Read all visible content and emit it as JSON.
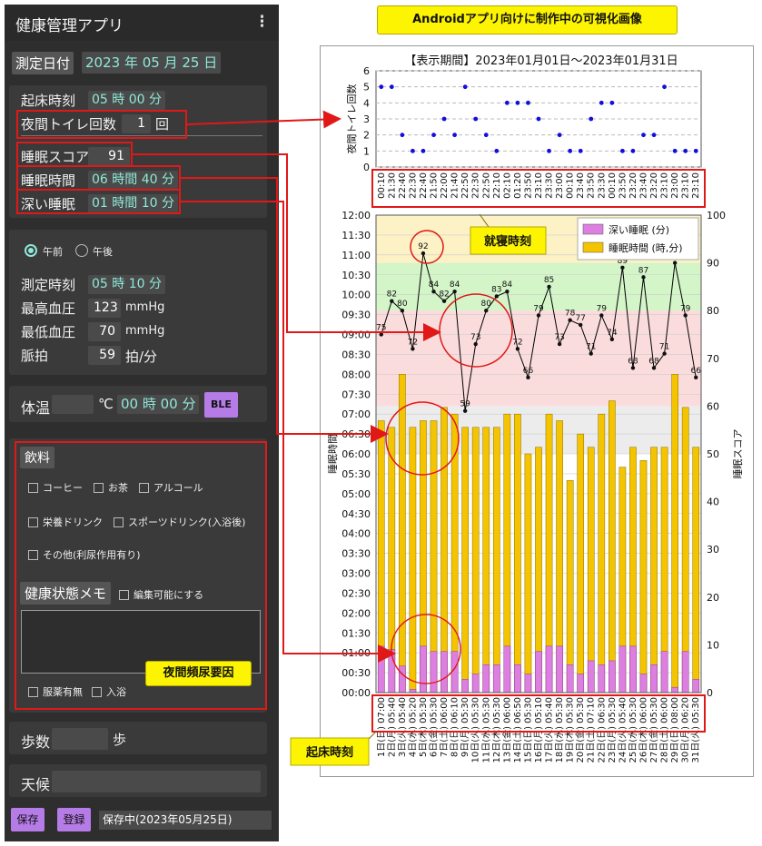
{
  "app": {
    "title": "健康管理アプリ",
    "menu_icon": "⋮"
  },
  "date_row": {
    "label": "測定日付",
    "value": "2023 年 05 月 25 日"
  },
  "sleep": {
    "wake_label": "起床時刻",
    "wake_value": "05 時 00 分",
    "toilet_label": "夜間トイレ回数",
    "toilet_value": "1",
    "toilet_unit": "回",
    "score_label": "睡眠スコア",
    "score_value": "91",
    "duration_label": "睡眠時間",
    "duration_value": "06 時間 40 分",
    "deep_label": "深い睡眠",
    "deep_value": "01 時間 10 分"
  },
  "blood": {
    "am_label": "午前",
    "pm_label": "午後",
    "time_label": "測定時刻",
    "time_value": "05 時 10 分",
    "sys_label": "最高血圧",
    "sys_value": "123",
    "sys_unit": "mmHg",
    "dia_label": "最低血圧",
    "dia_value": "70",
    "dia_unit": "mmHg",
    "pulse_label": "脈拍",
    "pulse_value": "59",
    "pulse_unit": "拍/分"
  },
  "temp": {
    "label": "体温",
    "unit": "℃",
    "time_value": "00 時 00 分",
    "ble_label": "BLE"
  },
  "drinks": {
    "header": "飲料",
    "items": [
      "コーヒー",
      "お茶",
      "アルコール",
      "栄養ドリンク",
      "スポーツドリンク(入浴後)",
      "その他(利尿作用有り)"
    ]
  },
  "memo": {
    "header": "健康状態メモ",
    "editable_label": "編集可能にする",
    "med_label": "服薬有無",
    "bath_label": "入浴"
  },
  "steps": {
    "label": "歩数",
    "unit": "歩"
  },
  "weather": {
    "label": "天候"
  },
  "footer": {
    "save_label": "保存",
    "register_label": "登録",
    "status": "保存中(2023年05月25日)"
  },
  "annotations": {
    "top": "Androidアプリ向けに制作中の可視化画像",
    "bedtime": "就寝時刻",
    "nocturia": "夜間頻尿要因",
    "wake": "起床時刻"
  },
  "colors": {
    "deep_sleep": "#dd7fe0",
    "sleep_time": "#f4c400",
    "score_line": "#000000",
    "toilet_dot": "#1010dd",
    "highlight": "#e01818",
    "note": "#fcf400"
  },
  "chart_data": [
    {
      "type": "scatter",
      "title": "【表示期間】2023年01月01日〜2023年01月31日",
      "ylabel": "夜間トイレ回数",
      "ylim": [
        0,
        6
      ],
      "yticks": [
        0,
        1,
        2,
        3,
        4,
        5,
        6
      ],
      "grid": true,
      "categories": [
        "00:10",
        "21:30",
        "22:40",
        "22:30",
        "22:40",
        "21:50",
        "22:00",
        "21:40",
        "22:50",
        "22:30",
        "22:50",
        "22:10",
        "02:10",
        "01:20",
        "23:50",
        "23:10",
        "23:30",
        "23:00",
        "00:10",
        "23:40",
        "23:50",
        "23:30",
        "00:10",
        "23:50",
        "23:20",
        "23:40",
        "23:20",
        "23:10",
        "23:00",
        "23:10",
        "23:10"
      ],
      "values": [
        5,
        5,
        2,
        1,
        1,
        2,
        3,
        2,
        5,
        3,
        2,
        1,
        4,
        4,
        4,
        3,
        1,
        2,
        1,
        1,
        3,
        4,
        4,
        1,
        1,
        2,
        2,
        5,
        1,
        1,
        1
      ]
    },
    {
      "type": "bar",
      "xlabel": "",
      "ylabel": "睡眠時間",
      "y2label": "睡眠スコア",
      "ylim": [
        "00:00",
        "12:00"
      ],
      "y2lim": [
        0,
        100
      ],
      "yticks": [
        "00:00",
        "00:30",
        "01:00",
        "01:30",
        "02:00",
        "02:30",
        "03:00",
        "03:30",
        "04:00",
        "04:30",
        "05:00",
        "05:30",
        "06:00",
        "06:30",
        "07:00",
        "07:30",
        "08:00",
        "08:30",
        "09:00",
        "09:30",
        "10:00",
        "10:30",
        "11:00",
        "11:30",
        "12:00"
      ],
      "y2ticks": [
        0,
        10,
        20,
        30,
        40,
        50,
        60,
        70,
        80,
        90,
        100
      ],
      "legend_position": "top-right",
      "background_bands": [
        {
          "from": 90,
          "to": 100,
          "color": "#fdf1c6"
        },
        {
          "from": 80,
          "to": 90,
          "color": "#d3f5c8"
        },
        {
          "from": 60,
          "to": 80,
          "color": "#fbdcdc"
        },
        {
          "from": 50,
          "to": 60,
          "color": "#ececec"
        }
      ],
      "categories": [
        "1日(日)",
        "2日(月)",
        "3日(火)",
        "4日(水)",
        "5日(木)",
        "6日(金)",
        "7日(土)",
        "8日(日)",
        "9日(月)",
        "10日(火)",
        "11日(水)",
        "12日(木)",
        "13日(金)",
        "14日(土)",
        "15日(日)",
        "16日(月)",
        "17日(火)",
        "18日(水)",
        "19日(木)",
        "20日(金)",
        "21日(土)",
        "22日(日)",
        "23日(月)",
        "24日(火)",
        "25日(水)",
        "26日(木)",
        "27日(金)",
        "28日(土)",
        "29日(日)",
        "30日(月)",
        "31日(火)"
      ],
      "wake_times": [
        "07:00",
        "05:40",
        "05:40",
        "05:20",
        "05:30",
        "05:30",
        "06:00",
        "06:10",
        "05:30",
        "05:30",
        "05:30",
        "05:30",
        "06:00",
        "06:50",
        "05:30",
        "05:10",
        "05:40",
        "05:30",
        "05:30",
        "05:30",
        "07:10",
        "06:30",
        "05:30",
        "05:40",
        "05:30",
        "06:00",
        "05:30",
        "06:00",
        "08:00",
        "06:20",
        "05:30"
      ],
      "series": [
        {
          "name": "深い睡眠 (分)",
          "values": [
            70,
            65,
            40,
            5,
            70,
            62,
            62,
            62,
            20,
            28,
            42,
            42,
            70,
            42,
            28,
            62,
            70,
            70,
            42,
            28,
            48,
            42,
            48,
            70,
            70,
            28,
            42,
            62,
            8,
            62,
            20
          ]
        },
        {
          "name": "睡眠時間 (時,分)",
          "values": [
            "06:50",
            "06:40",
            "08:00",
            "06:40",
            "06:50",
            "06:50",
            "07:10",
            "07:00",
            "06:40",
            "06:40",
            "06:40",
            "06:40",
            "07:00",
            "07:00",
            "06:00",
            "06:10",
            "07:00",
            "06:50",
            "05:20",
            "06:30",
            "06:10",
            "07:00",
            "07:20",
            "05:40",
            "06:10",
            "05:50",
            "06:10",
            "06:10",
            "08:00",
            "07:10",
            "06:10"
          ]
        },
        {
          "name": "睡眠スコア",
          "values": [
            75,
            82,
            80,
            72,
            92,
            84,
            82,
            84,
            59,
            73,
            80,
            83,
            84,
            72,
            66,
            79,
            85,
            73,
            78,
            77,
            71,
            79,
            74,
            89,
            68,
            87,
            68,
            71,
            90,
            79,
            66
          ]
        }
      ]
    }
  ]
}
